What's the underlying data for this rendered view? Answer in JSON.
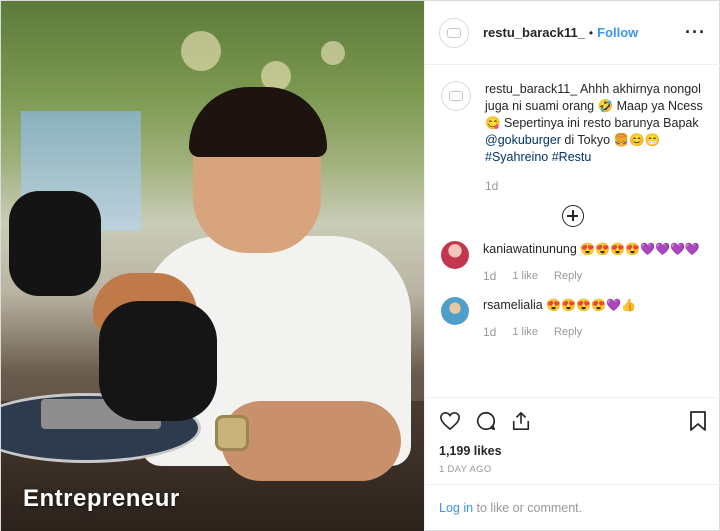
{
  "post": {
    "username": "restu_barack11_",
    "follow_label": "Follow",
    "separator": "•",
    "more_label": "···",
    "photo_overlay_text": "Entrepreneur"
  },
  "caption": {
    "username": "restu_barack11_",
    "text_1": " Ahhh akhirnya nongol juga ni suami orang 🤣 Maap ya Ncess 😋 Sepertinya ini resto barunya Bapak ",
    "mention": "@gokuburger",
    "text_2": " di Tokyo 🍔😊😁",
    "hashtag_1": "#Syahreino",
    "hashtag_2": "#Restu",
    "time": "1d"
  },
  "comments": [
    {
      "username": "kaniawatinunung",
      "emojis": "😍😍😍😍💜💜💜💜",
      "time": "1d",
      "likes": "1 like",
      "reply": "Reply",
      "avatar_color": "#c2374f"
    },
    {
      "username": "rsamelialia",
      "emojis": "😍😍😍😍💜👍",
      "time": "1d",
      "likes": "1 like",
      "reply": "Reply",
      "avatar_color": "#4e9fc9"
    }
  ],
  "stats": {
    "likes": "1,199 likes",
    "ago": "1 DAY AGO"
  },
  "footer": {
    "login_link": "Log in",
    "login_rest": " to like or comment."
  },
  "colors": {
    "accent": "#3897f0",
    "link": "#003569",
    "muted": "#999999"
  },
  "icons": [
    "heart-icon",
    "comment-icon",
    "share-icon",
    "bookmark-icon",
    "add-comment-icon",
    "more-options-icon"
  ]
}
